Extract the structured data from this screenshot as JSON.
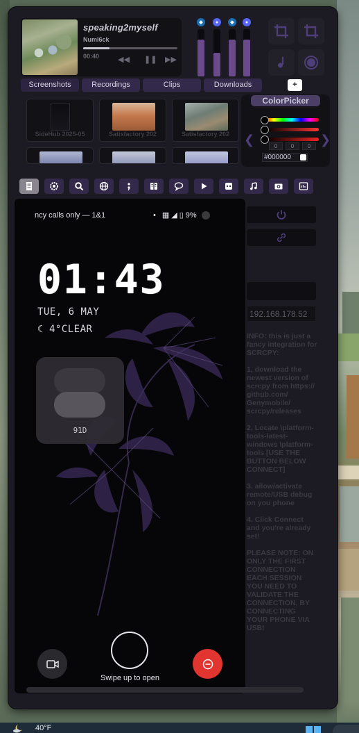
{
  "media": {
    "title": "speaking2myself",
    "artist": "Numl6ck",
    "time": "00:40",
    "progress": 0.28
  },
  "sliders": [
    {
      "icon": "steam-icon",
      "level": 0.78
    },
    {
      "icon": "discord-icon",
      "level": 0.5
    },
    {
      "icon": "steam-icon",
      "level": 0.78
    },
    {
      "icon": "discord-icon",
      "level": 0.78
    }
  ],
  "tabs": [
    "Screenshots",
    "Recordings",
    "Clips",
    "Downloads"
  ],
  "add_label": "+",
  "thumbnails": [
    {
      "caption": "SideHub 2025-05"
    },
    {
      "caption": "Satisfactory   202"
    },
    {
      "caption": "Satisfactory   202"
    }
  ],
  "colorpicker": {
    "title": "ColorPicker",
    "rgb": [
      "0",
      "0",
      "0"
    ],
    "hex": "#000000"
  },
  "toolbar_icons": [
    "doc-icon",
    "cog-icon",
    "search-icon",
    "globe-icon",
    "semicolon-icon",
    "book-icon",
    "chat-icon",
    "play-icon",
    "gamepad-icon",
    "music-icon",
    "camera-icon",
    "terminal-icon"
  ],
  "phone": {
    "carrier": "ncy calls only — 1&1",
    "battery": "9%",
    "clock": "01:43",
    "date": "TUE, 6 MAY",
    "weather": "4°CLEAR",
    "widget_pct": "91D",
    "swipe_text": "Swipe up to open"
  },
  "side": {
    "ip": "192.168.178.52",
    "info": [
      "INFO: this is just a fancy integration for SCRCPY:",
      "1,  download the newest version of scrcpy from https:// github.com/ Genymobile/ scrcpy/releases",
      "2. Locate \\platform-tools-latest-windows \\platform-tools [USE THE BUTTON BELOW CONNECT]",
      "3. allow/activate remote/USB debug on you phone",
      "4. Click Connect and you're already set!",
      "PLEASE NOTE: ON ONLY THE FIRST CONNECTION EACH SESSION YOU NEED TO VALIDATE THE CONNECTION, BY CONNECTING YOUR PHONE VIA USB!"
    ]
  },
  "taskbar": {
    "temp": "40°F"
  }
}
